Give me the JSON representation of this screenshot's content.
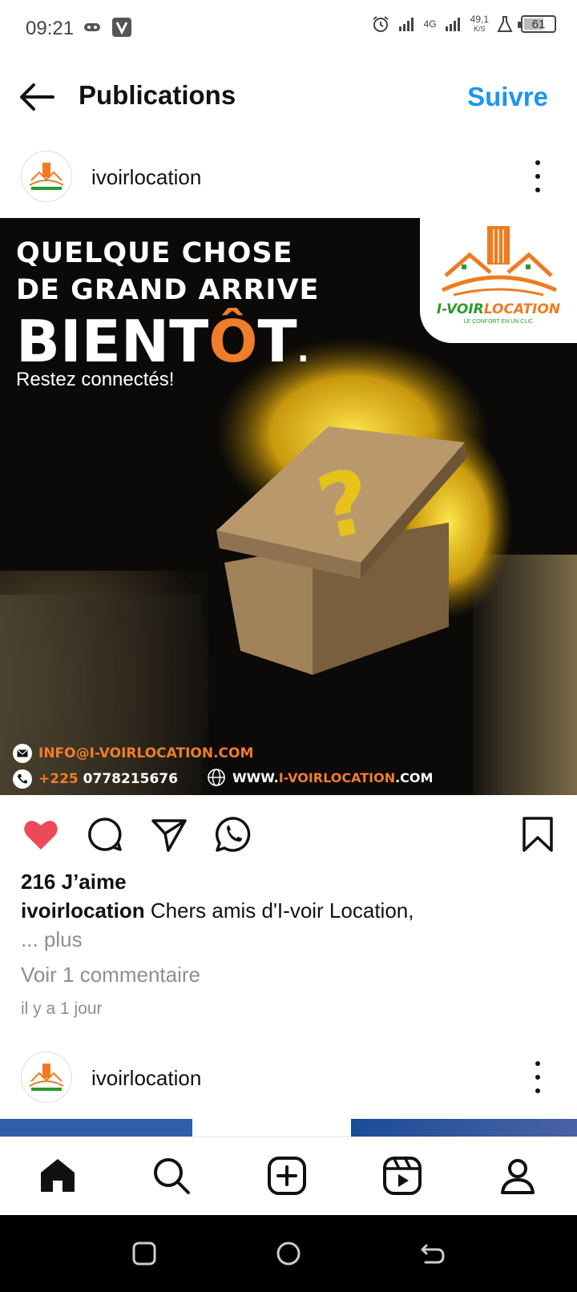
{
  "status_bar": {
    "time": "09:21",
    "network": "4G",
    "speed_value": "49,1",
    "speed_unit": "K/S",
    "battery": "61"
  },
  "header": {
    "title": "Publications",
    "follow_label": "Suivre"
  },
  "post": {
    "username": "ivoirlocation",
    "image": {
      "line1": "QUELQUE CHOSE",
      "line2": "DE GRAND ARRIVE",
      "line3_a": "BIENT",
      "line3_o": "Ô",
      "line3_b": "T",
      "line3_dot": ".",
      "subtitle": "Restez connectés!",
      "logo_brand_a": "I-VOIR",
      "logo_brand_b": "LOCATION",
      "logo_tagline": "LE CONFORT EN UN CLIC",
      "email_a": "INFO@",
      "email_b": "I-VOIRLOCATION.COM",
      "phone_prefix": "+225",
      "phone_number": "0778215676",
      "web_a": "WWW.",
      "web_b": "I-VOIRLOCATION",
      "web_c": ".COM"
    },
    "likes": "216 J’aime",
    "caption_user": "ivoirlocation",
    "caption_text": "Chers amis d'I-voir Location,",
    "more": "... plus",
    "comments": "Voir 1 commentaire",
    "time_ago": "il y a 1 jour"
  },
  "next_post": {
    "username": "ivoirlocation"
  },
  "colors": {
    "accent_blue": "#1a95f0",
    "like_red": "#ed4956",
    "brand_orange": "#f07d2a",
    "brand_green": "#2a9a2e"
  },
  "icons": {
    "back": "arrow-left-icon",
    "more": "more-vertical-icon",
    "like": "heart-filled-icon",
    "comment": "comment-icon",
    "share": "send-icon",
    "whatsapp": "whatsapp-icon",
    "save": "bookmark-icon",
    "nav_home": "home-icon",
    "nav_search": "search-icon",
    "nav_create": "plus-square-icon",
    "nav_reels": "reels-icon",
    "nav_profile": "profile-icon"
  }
}
